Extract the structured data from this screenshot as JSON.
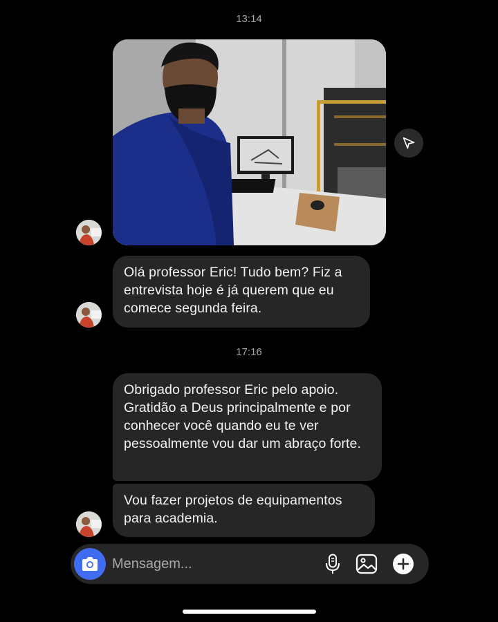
{
  "conversation": {
    "timestamp_1": "13:14",
    "timestamp_2": "17:16",
    "messages": [
      {
        "text": "Olá professor Eric! Tudo bem? Fiz a entrevista hoje é já querem que eu comece segunda feira."
      },
      {
        "text": "Obrigado professor Eric pelo apoio. Gratidão a Deus principalmente e por conhecer você quando eu te ver pessoalmente vou dar um abraço forte."
      },
      {
        "text": "Vou fazer projetos de equipamentos para academia."
      }
    ]
  },
  "composer": {
    "placeholder": "Mensagem..."
  },
  "icons": {
    "camera": "camera-icon",
    "share": "paper-plane-icon",
    "microphone": "microphone-icon",
    "gallery": "gallery-icon",
    "add": "plus-icon"
  },
  "colors": {
    "background": "#000000",
    "bubble": "#262626",
    "accent": "#3f6cf0",
    "timestamp": "#a8a8a8"
  }
}
